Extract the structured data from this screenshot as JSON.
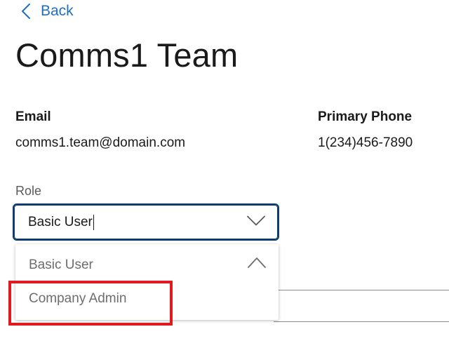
{
  "nav": {
    "back_label": "Back"
  },
  "page": {
    "title": "Comms1 Team"
  },
  "contact": {
    "email_label": "Email",
    "email_value": "comms1.team@domain.com",
    "phone_label": "Primary Phone",
    "phone_value": "1(234)456-7890"
  },
  "role": {
    "label": "Role",
    "selected_value": "Basic User",
    "options": [
      {
        "label": "Basic User",
        "selected": true
      },
      {
        "label": "Company Admin",
        "selected": false
      }
    ]
  },
  "colors": {
    "link": "#1f6fc1",
    "select_border": "#0d3d6e",
    "highlight": "#e01b1f"
  }
}
